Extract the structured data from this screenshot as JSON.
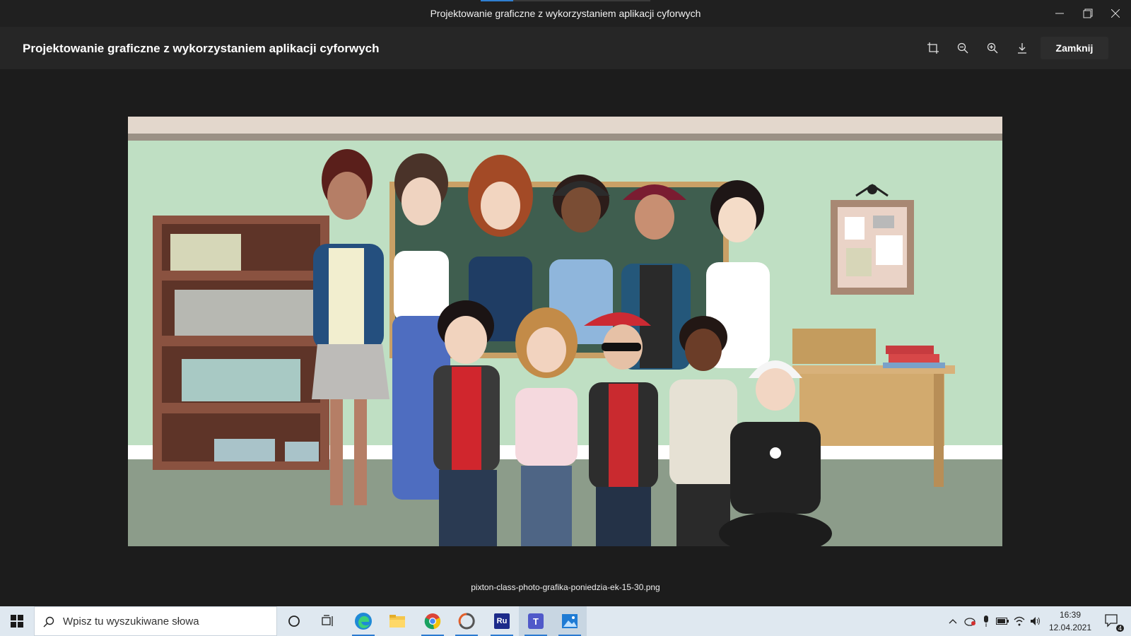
{
  "window": {
    "title": "Projektowanie graficzne z wykorzystaniem aplikacji cyforwych"
  },
  "viewer": {
    "title": "Projektowanie graficzne z wykorzystaniem aplikacji cyforwych",
    "close_label": "Zamknij",
    "tools": [
      "crop-icon",
      "zoom-out-icon",
      "zoom-in-icon",
      "download-icon"
    ]
  },
  "image": {
    "filename": "pixton-class-photo-grafika-poniedzia-ek-15-30.png"
  },
  "taskbar": {
    "search_placeholder": "Wpisz tu wyszukiwane słowa",
    "apps": [
      "cortana-icon",
      "task-view-icon",
      "edge-icon",
      "file-explorer-icon",
      "chrome-icon",
      "app-icon",
      "ru-app-icon",
      "teams-icon",
      "photos-icon"
    ],
    "ru_label": "Ru",
    "teams_label": "T",
    "time": "16:39",
    "date": "12.04.2021",
    "notification_count": "4"
  },
  "colors": {
    "titlebar": "#202020",
    "viewerbar": "#262626",
    "taskbar": "#dfe8f0",
    "accent": "#2f7fd1"
  }
}
